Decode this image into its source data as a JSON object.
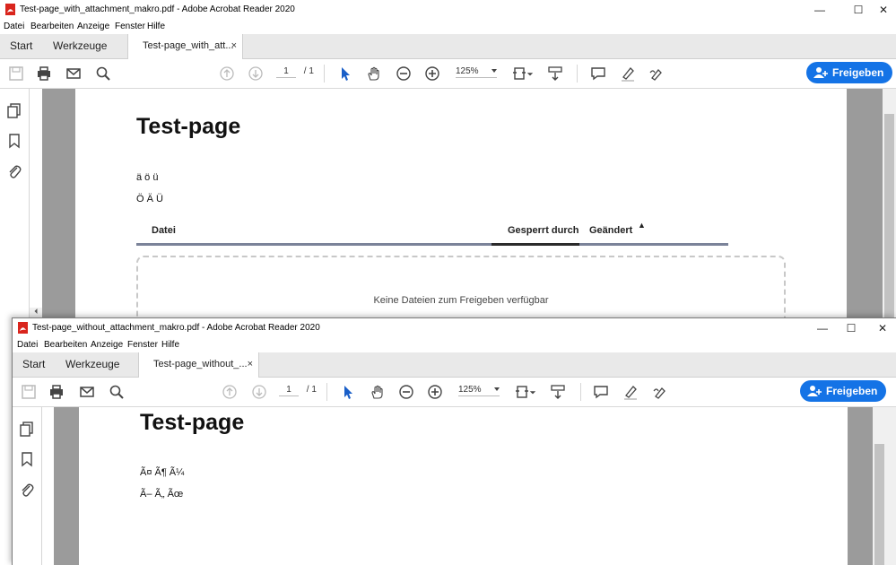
{
  "window1": {
    "title": "Test-page_with_attachment_makro.pdf - Adobe Acrobat Reader 2020",
    "menu": [
      "Datei",
      "Bearbeiten",
      "Anzeige",
      "Fenster",
      "Hilfe"
    ],
    "tabs": {
      "start": "Start",
      "tools": "Werkzeuge",
      "doc": "Test-page_with_att...",
      "close": "×"
    },
    "toolbar": {
      "page_current": "1",
      "page_total": "/ 1",
      "zoom": "125%",
      "share_label": "Freigeben"
    },
    "page": {
      "heading": "Test-page",
      "line1": "ä ö ü",
      "line2": "Ö Ä Ü",
      "table": {
        "col_file": "Datei",
        "col_locked": "Gesperrt durch",
        "col_changed": "Geändert",
        "sort_glyph": "▲"
      },
      "empty_message": "Keine Dateien zum Freigeben verfügbar"
    }
  },
  "window2": {
    "title": "Test-page_without_attachment_makro.pdf - Adobe Acrobat Reader 2020",
    "menu": [
      "Datei",
      "Bearbeiten",
      "Anzeige",
      "Fenster",
      "Hilfe"
    ],
    "tabs": {
      "start": "Start",
      "tools": "Werkzeuge",
      "doc": "Test-page_without_...",
      "close": "×"
    },
    "toolbar": {
      "page_current": "1",
      "page_total": "/ 1",
      "zoom": "125%",
      "share_label": "Freigeben"
    },
    "page": {
      "heading": "Test-page",
      "line1": "Ã¤ Ã¶ Ã¼",
      "line2": "Ã– Ã„ Ãœ"
    }
  },
  "window_controls": {
    "minimize": "—",
    "maximize": "☐",
    "close": "✕"
  },
  "colors": {
    "accent": "#1473e6",
    "pdf_red": "#d9251d",
    "doc_bg": "#9b9b9b"
  }
}
